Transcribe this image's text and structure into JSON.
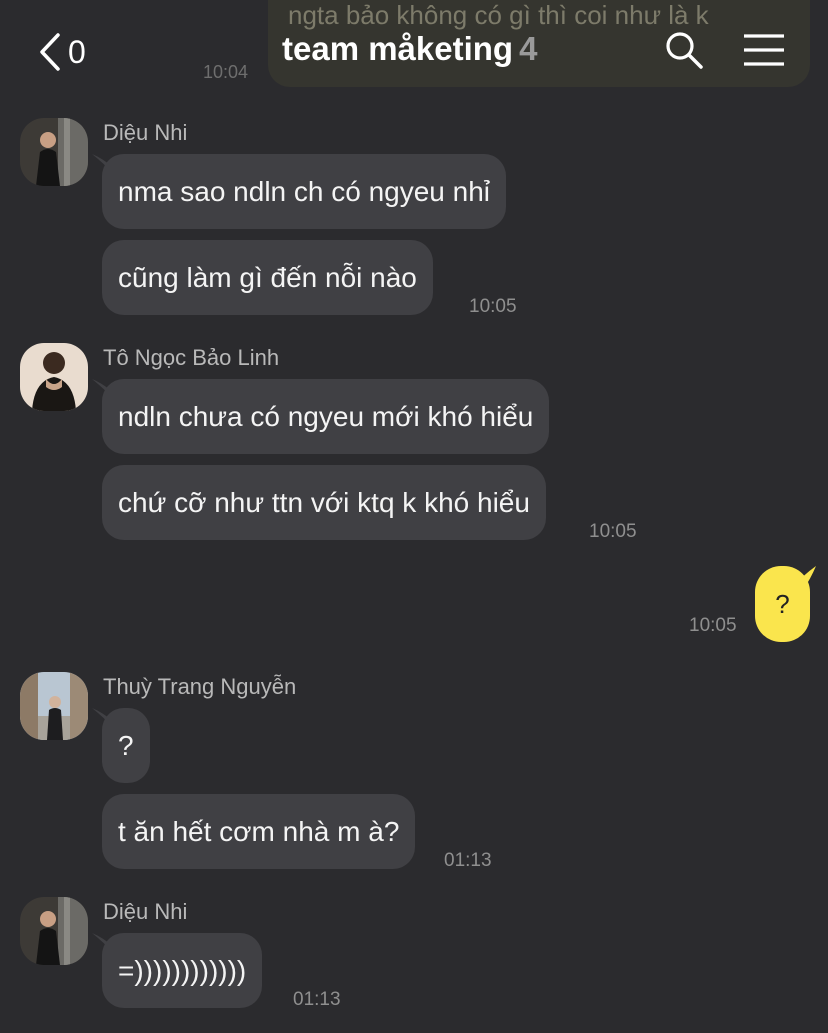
{
  "ghost": {
    "text": "ngta bảo không có gì thì coi như là k",
    "time": "10:04"
  },
  "header": {
    "back_count": "0",
    "title": "team måketing",
    "member_count": "4"
  },
  "messages": {
    "g1": {
      "sender": "Diệu Nhi",
      "m1": "nma sao ndln ch có ngyeu nhỉ",
      "m2": "cũng làm gì đến nỗi nào",
      "time": "10:05"
    },
    "g2": {
      "sender": "Tô Ngọc Bảo Linh",
      "m1": "ndln chưa có ngyeu mới khó hiểu",
      "m2": "chứ cỡ như ttn với ktq k khó hiểu",
      "time": "10:05"
    },
    "me": {
      "text": "?",
      "time": "10:05"
    },
    "g3": {
      "sender": "Thuỳ Trang Nguyễn",
      "m1": "?",
      "m2": "t ăn hết cơm nhà m à?",
      "time": "01:13"
    },
    "g4": {
      "sender": "Diệu Nhi",
      "m1": "=))))))))))))",
      "time": "01:13"
    }
  },
  "colors": {
    "background": "#2b2b2e",
    "bubble_other": "#404044",
    "bubble_me": "#fae54d"
  }
}
